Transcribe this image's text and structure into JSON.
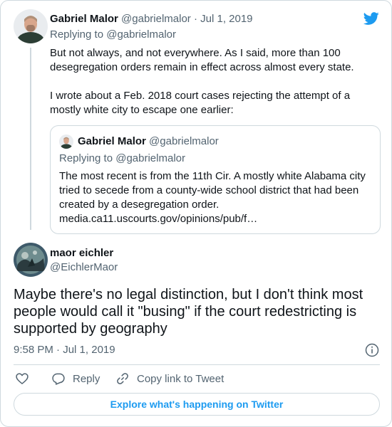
{
  "brand": {
    "accent": "#1d9bf0",
    "icon": "twitter-bird-icon"
  },
  "parent_tweet": {
    "author_name": "Gabriel Malor",
    "author_handle": "@gabrielmalor",
    "date_sep": " · ",
    "date": "Jul 1, 2019",
    "replying_prefix": "Replying to ",
    "replying_handle": "@gabrielmalor",
    "paragraphs": [
      "But not always, and not everywhere. As I said, more than 100 desegregation orders remain in effect across almost every state.",
      "I wrote about a Feb. 2018 court cases rejecting the attempt of a mostly white city to escape one earlier:"
    ]
  },
  "quoted_tweet": {
    "author_name": "Gabriel Malor",
    "author_handle": "@gabrielmalor",
    "replying_prefix": "Replying to ",
    "replying_handle": "@gabrielmalor",
    "text": "The most recent is from the 11th Cir. A mostly white Alabama city tried to secede from a county-wide school district that had been created by a desegregation order.",
    "link": "media.ca11.uscourts.gov/opinions/pub/f…"
  },
  "main_tweet": {
    "author_name": "maor eichler",
    "author_handle": "@EichlerMaor",
    "text": "Maybe there's no legal distinction, but I don't think most people would call it \"busing\" if the court redestricting is supported by geography",
    "time": "9:58 PM",
    "date_sep": " · ",
    "date": "Jul 1, 2019"
  },
  "actions": {
    "reply_label": "Reply",
    "copy_label": "Copy link to Tweet"
  },
  "footer": {
    "explore_label": "Explore what's happening on Twitter"
  }
}
